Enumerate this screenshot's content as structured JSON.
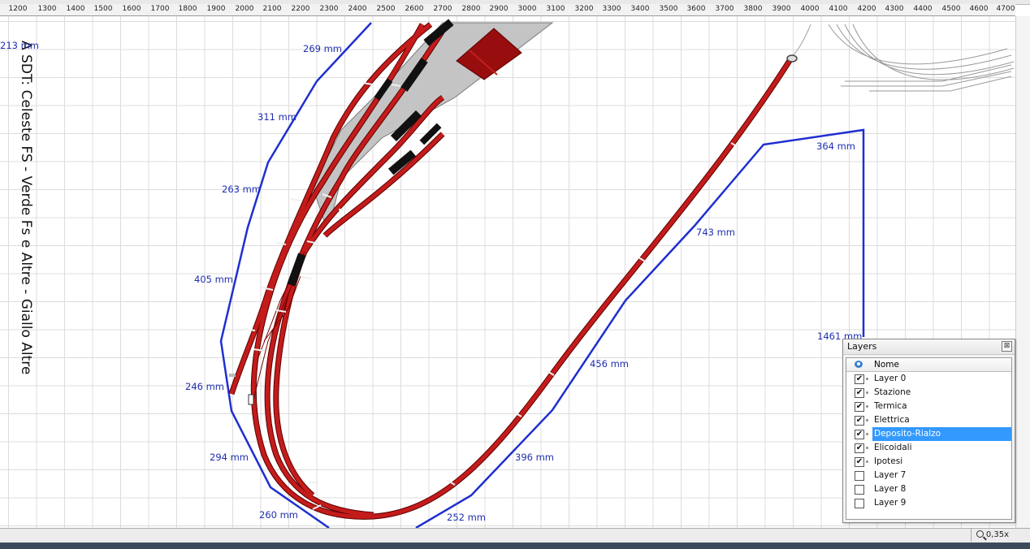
{
  "ruler": {
    "labels": [
      "1200",
      "1300",
      "1400",
      "1500",
      "1600",
      "1700",
      "1800",
      "1900",
      "2000",
      "2100",
      "2200",
      "2300",
      "2400",
      "2500",
      "2600",
      "2700",
      "2800",
      "2900",
      "3000",
      "3100",
      "3200",
      "3300",
      "3400",
      "3500",
      "3600",
      "3700",
      "3800",
      "3900",
      "4000",
      "4100",
      "4200",
      "4300",
      "4400",
      "4500",
      "4600",
      "4700"
    ]
  },
  "canvas": {
    "legend_text": "A SDT: Celeste FS - Verde Fs e Altre - Giallo Altre",
    "dimensions": [
      "269 mm",
      "311 mm",
      "263 mm",
      "405 mm",
      "246 mm",
      "294 mm",
      "260 mm",
      "252 mm",
      "396 mm",
      "456 mm",
      "743 mm",
      "364 mm",
      "1461 mm",
      "213 mm"
    ]
  },
  "layers_panel": {
    "title": "Layers",
    "close_label": "⊠",
    "column_name": "Nome",
    "rows": [
      {
        "name": "Layer 0",
        "checked": true,
        "selected": false
      },
      {
        "name": "Stazione",
        "checked": true,
        "selected": false
      },
      {
        "name": "Termica",
        "checked": true,
        "selected": false
      },
      {
        "name": "Elettrica",
        "checked": true,
        "selected": false
      },
      {
        "name": "Deposito-Rialzo",
        "checked": true,
        "selected": true
      },
      {
        "name": "Elicoidali",
        "checked": true,
        "selected": false
      },
      {
        "name": "Ipotesi",
        "checked": true,
        "selected": false
      },
      {
        "name": "Layer 7",
        "checked": false,
        "selected": false
      },
      {
        "name": "Layer 8",
        "checked": false,
        "selected": false
      },
      {
        "name": "Layer 9",
        "checked": false,
        "selected": false
      }
    ]
  },
  "statusbar": {
    "zoom": "0,35x"
  },
  "colors": {
    "track_red": "#c41b1b",
    "dimension_blue": "#1f2fd0",
    "platform_gray": "#c4c4c4",
    "selection_blue": "#3399ff"
  }
}
